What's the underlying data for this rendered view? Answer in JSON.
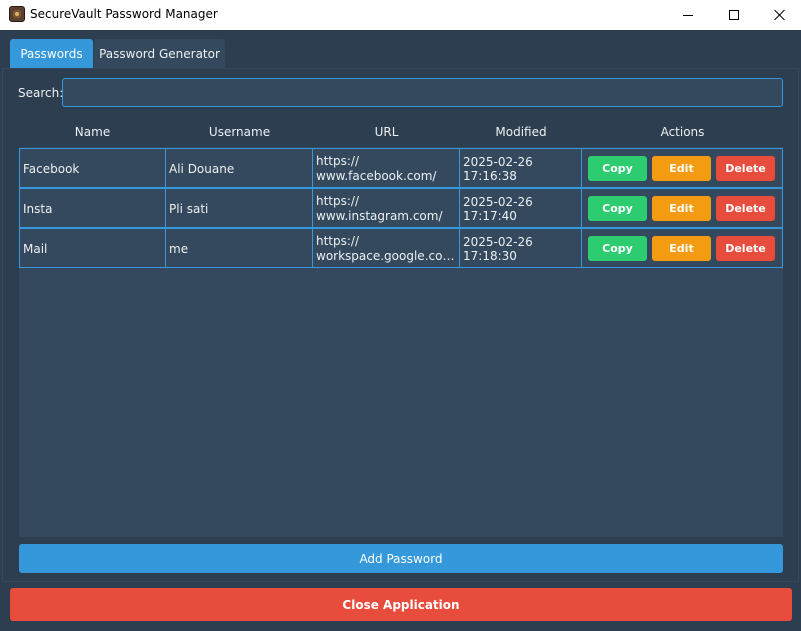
{
  "window": {
    "title": "SecureVault Password Manager"
  },
  "tabs": [
    {
      "label": "Passwords",
      "active": true
    },
    {
      "label": "Password Generator",
      "active": false
    }
  ],
  "search": {
    "label": "Search:",
    "value": "",
    "placeholder": ""
  },
  "table": {
    "headers": [
      "Name",
      "Username",
      "URL",
      "Modified",
      "Actions"
    ],
    "rows": [
      {
        "name": "Facebook",
        "username": "Ali Douane",
        "url_line1": "https://",
        "url_line2": "www.facebook.com/",
        "modified": "2025-02-26 17:16:38"
      },
      {
        "name": "Insta",
        "username": "Pli sati",
        "url_line1": "https://",
        "url_line2": "www.instagram.com/",
        "modified": "2025-02-26 17:17:40"
      },
      {
        "name": "Mail",
        "username": "me",
        "url_line1": "https://",
        "url_line2": "workspace.google.com/...",
        "modified": "2025-02-26 17:18:30"
      }
    ],
    "actions": {
      "copy": "Copy",
      "edit": "Edit",
      "delete": "Delete"
    }
  },
  "buttons": {
    "add_password": "Add Password",
    "close_application": "Close Application"
  },
  "colors": {
    "background": "#2c3e50",
    "panel": "#34495e",
    "accent": "#3498db",
    "copy": "#2ecc71",
    "edit": "#f39c12",
    "delete": "#e74c3c"
  },
  "icons": {
    "app": "vault-shield-icon",
    "minimize": "minimize-icon",
    "maximize": "maximize-icon",
    "close": "close-icon"
  }
}
